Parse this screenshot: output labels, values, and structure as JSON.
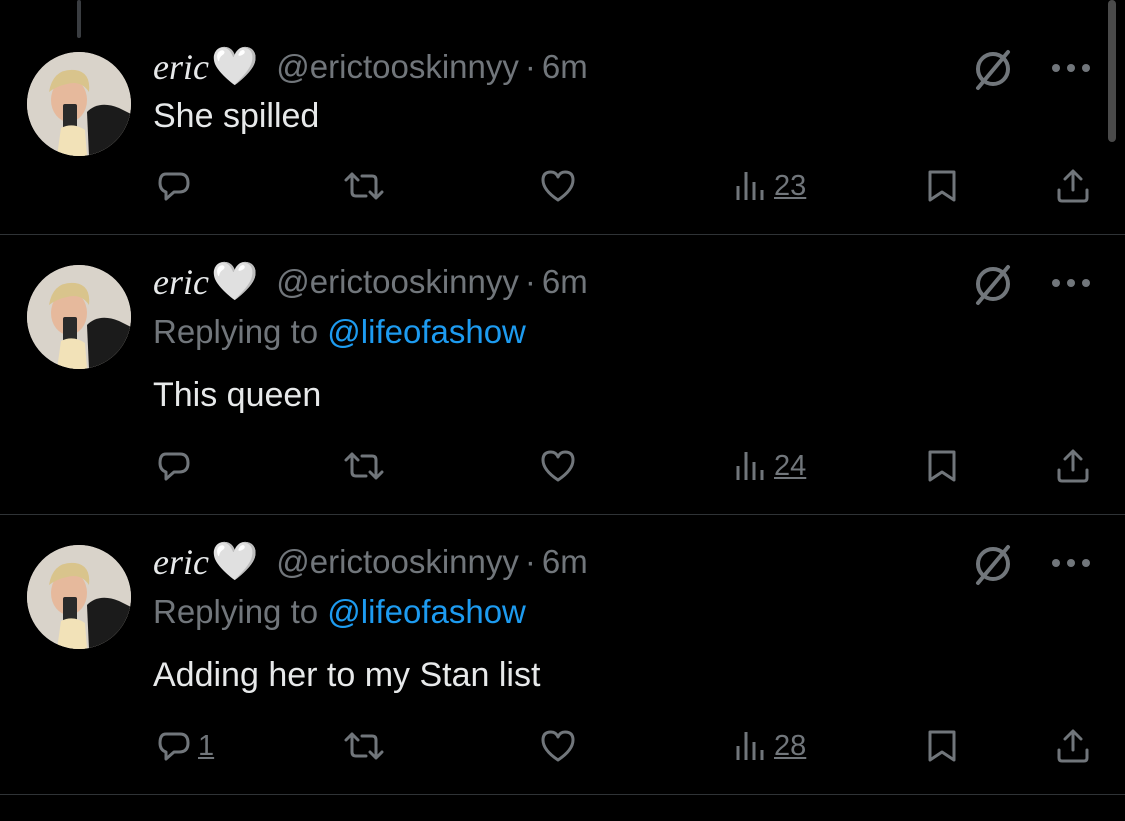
{
  "tweets": [
    {
      "author_name": "eric",
      "author_emoji": "🤍",
      "handle": "@erictooskinnyy",
      "separator": "·",
      "time": "6m",
      "replying_prefix": "",
      "replying_to": "",
      "text": "She spilled",
      "reply_count": "",
      "views": "23"
    },
    {
      "author_name": "eric",
      "author_emoji": "🤍",
      "handle": "@erictooskinnyy",
      "separator": "·",
      "time": "6m",
      "replying_prefix": "Replying to",
      "replying_to": "@lifeofashow",
      "text": "This queen",
      "reply_count": "",
      "views": "24"
    },
    {
      "author_name": "eric",
      "author_emoji": "🤍",
      "handle": "@erictooskinnyy",
      "separator": "·",
      "time": "6m",
      "replying_prefix": "Replying to",
      "replying_to": "@lifeofashow",
      "text": "Adding her to my Stan list",
      "reply_count": "1",
      "views": "28"
    }
  ],
  "icons": [
    "reply-icon",
    "retweet-icon",
    "like-icon",
    "views-icon",
    "bookmark-icon",
    "share-icon",
    "grok-icon",
    "more-icon"
  ],
  "colors": {
    "background": "#000000",
    "text": "#e7e9ea",
    "muted": "#71767b",
    "link": "#1d9bf0",
    "divider": "#2f3336"
  }
}
